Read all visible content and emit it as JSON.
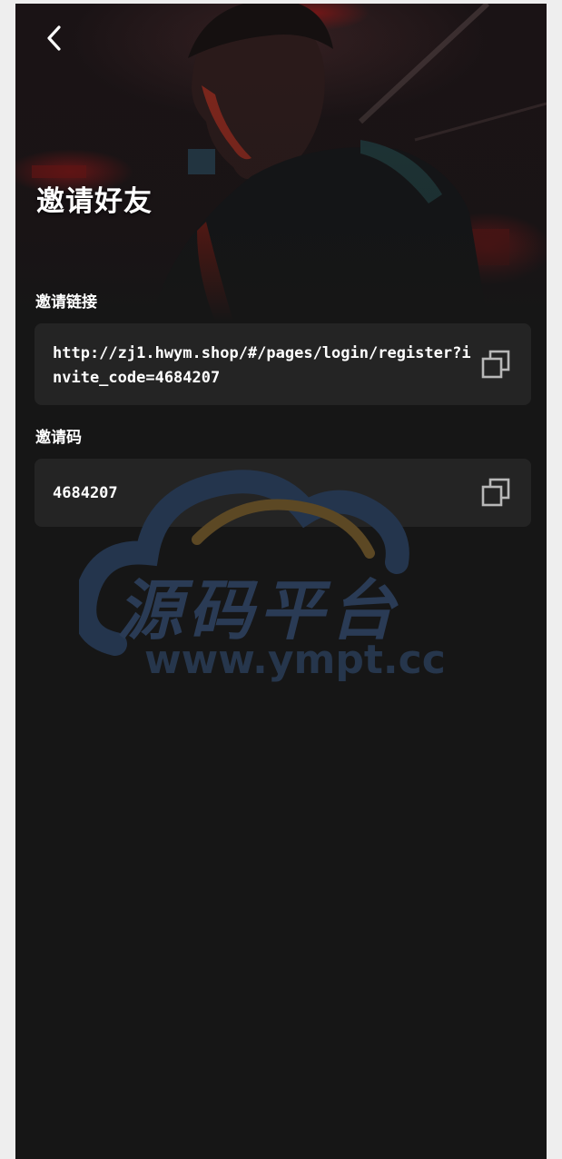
{
  "header": {
    "title": "邀请好友"
  },
  "invite_link": {
    "label": "邀请链接",
    "value": "http://zj1.hwym.shop/#/pages/login/register?invite_code=4684207"
  },
  "invite_code": {
    "label": "邀请码",
    "value": "4684207"
  },
  "watermark": {
    "brand": "源码平台",
    "url": "www.ympt.cc"
  },
  "icons": {
    "back": "chevron-left-icon",
    "copy": "copy-icon"
  },
  "colors": {
    "background": "#161616",
    "card": "#242424",
    "text": "#ffffff",
    "watermark": "#2a3b55",
    "watermark_accent": "#6b5428"
  }
}
